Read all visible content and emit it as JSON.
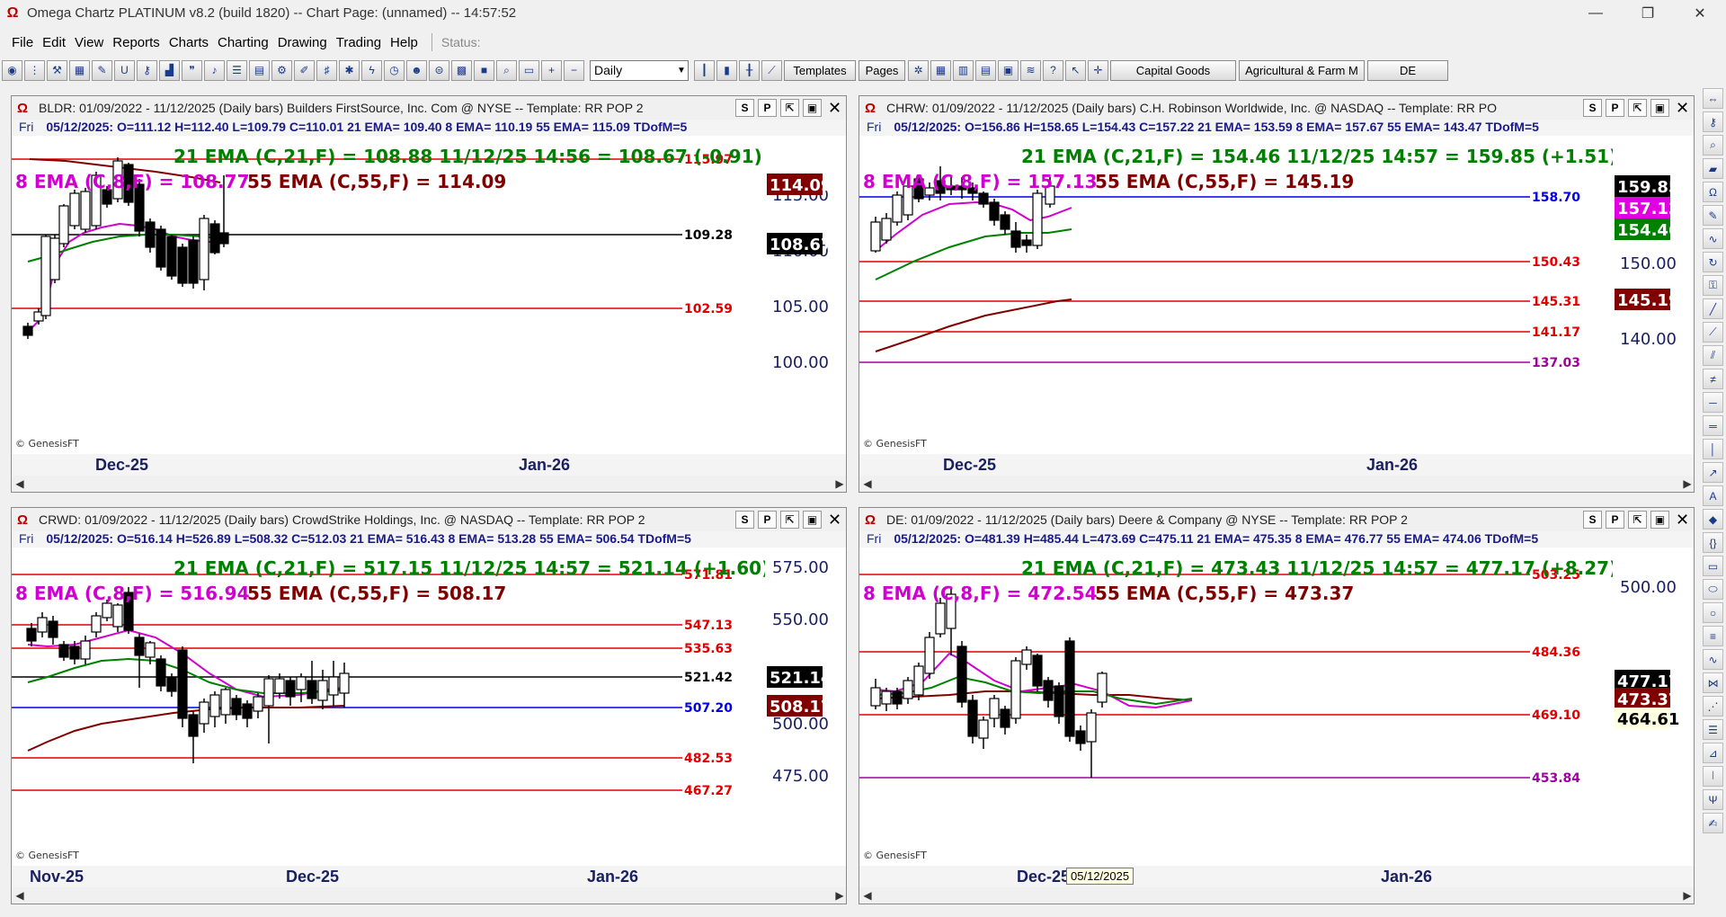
{
  "app": {
    "title": "Omega Chartz PLATINUM v8.2 (build 1820)  --  Chart Page: (unnamed) -- 14:57:52",
    "window_buttons": [
      "—",
      "❐",
      "✕"
    ]
  },
  "menu": {
    "items": [
      "File",
      "Edit",
      "View",
      "Reports",
      "Charts",
      "Charting",
      "Drawing",
      "Trading",
      "Help"
    ],
    "status": "Status:"
  },
  "toolbar": {
    "interval": "Daily",
    "buttons": [
      "Templates",
      "Pages",
      "Capital Goods",
      "Agricultural & Farm M",
      "DE"
    ]
  },
  "charts": [
    {
      "id": "bldr",
      "title": "BLDR: 01/09/2022 - 11/12/2025  (Daily bars)   Builders FirstSource, Inc. Com @ NYSE  --  Template: RR POP 2",
      "day": "Fri",
      "ohlc": "05/12/2025:  O=111.12  H=112.40  L=109.79  C=110.01  21 EMA= 109.40  8 EMA= 110.19  55 EMA= 115.09  TDofM=5",
      "line1": "21 EMA (C,21,F) = 108.88  11/12/25 14:56 = 108.67 (-0.91)",
      "line2a": "8 EMA (C,8,F) = 108.77",
      "line2b": "55 EMA (C,55,F) = 114.09",
      "price_labels": [
        "115.00",
        "110.00",
        "105.00",
        "100.00"
      ],
      "hlines": [
        {
          "label": "115.97",
          "color": "#e00000"
        },
        {
          "label": "109.28",
          "color": "#000000"
        },
        {
          "label": "102.59",
          "color": "#e00000"
        }
      ],
      "flags": [
        {
          "text": "114.09",
          "bg": "#800000",
          "fg": "#ffffff"
        },
        {
          "text": "108.67",
          "bg": "#000000",
          "fg": "#ffffff"
        }
      ],
      "x_labels": [
        "Dec-25",
        "Jan-26"
      ],
      "copyright": "© GenesisFT"
    },
    {
      "id": "chrw",
      "title": "CHRW: 01/09/2022 - 11/12/2025  (Daily bars)   C.H. Robinson Worldwide, Inc. @ NASDAQ  --  Template: RR PO",
      "day": "Fri",
      "ohlc": "05/12/2025:  O=156.86  H=158.65  L=154.43  C=157.22  21 EMA= 153.59  8 EMA= 157.67  55 EMA= 143.47  TDofM=5",
      "line1": "21 EMA (C,21,F) = 154.46  11/12/25 14:57 = 159.85 (+1.51)",
      "line2a": "8 EMA (C,8,F) = 157.13",
      "line2b": "55 EMA (C,55,F) = 145.19",
      "price_labels": [
        "150.00",
        "140.00"
      ],
      "hlines": [
        {
          "label": "158.70",
          "color": "#0000e0"
        },
        {
          "label": "150.43",
          "color": "#e00000"
        },
        {
          "label": "145.31",
          "color": "#e00000"
        },
        {
          "label": "141.17",
          "color": "#e00000"
        },
        {
          "label": "137.03",
          "color": "#a000a0"
        }
      ],
      "flags": [
        {
          "text": "159.85",
          "bg": "#000000",
          "fg": "#ffffff"
        },
        {
          "text": "157.13",
          "bg": "#e000e0",
          "fg": "#ffffff"
        },
        {
          "text": "154.46",
          "bg": "#008000",
          "fg": "#ffffff"
        },
        {
          "text": "145.19",
          "bg": "#800000",
          "fg": "#ffffff"
        }
      ],
      "x_labels": [
        "Dec-25",
        "Jan-26"
      ],
      "copyright": "© GenesisFT"
    },
    {
      "id": "crwd",
      "title": "CRWD:  01/09/2022 - 11/12/2025  (Daily bars)   CrowdStrike Holdings, Inc. @ NASDAQ  --  Template: RR POP 2",
      "day": "Fri",
      "ohlc": "05/12/2025:  O=516.14  H=526.89  L=508.32  C=512.03  21 EMA= 516.43  8 EMA= 513.28  55 EMA= 506.54  TDofM=5",
      "line1": "21 EMA (C,21,F) = 517.15  11/12/25 14:57 = 521.14 (+1.60)",
      "line2a": "8 EMA (C,8,F) = 516.94",
      "line2b": "55 EMA (C,55,F) = 508.17",
      "price_labels": [
        "575.00",
        "550.00",
        "500.00",
        "475.00"
      ],
      "hlines": [
        {
          "label": "571.81",
          "color": "#e00000"
        },
        {
          "label": "547.13",
          "color": "#e00000"
        },
        {
          "label": "535.63",
          "color": "#e00000"
        },
        {
          "label": "521.42",
          "color": "#000000"
        },
        {
          "label": "507.20",
          "color": "#0000e0"
        },
        {
          "label": "482.53",
          "color": "#e00000"
        },
        {
          "label": "467.27",
          "color": "#e00000"
        }
      ],
      "flags": [
        {
          "text": "521.14",
          "bg": "#000000",
          "fg": "#ffffff"
        },
        {
          "text": "508.17",
          "bg": "#800000",
          "fg": "#ffffff"
        }
      ],
      "x_labels": [
        "Nov-25",
        "Dec-25",
        "Jan-26"
      ],
      "copyright": "© GenesisFT"
    },
    {
      "id": "de",
      "title": "DE:  01/09/2022 - 11/12/2025  (Daily bars)   Deere & Company @ NYSE  --  Template: RR POP 2",
      "day": "Fri",
      "ohlc": "05/12/2025:  O=481.39  H=485.44  L=473.69  C=475.11  21 EMA= 475.35  8 EMA= 476.77  55 EMA= 474.06  TDofM=5",
      "line1": "21 EMA (C,21,F) = 473.43  11/12/25 14:57 = 477.17 (+8.27)",
      "line2a": "8 EMA (C,8,F) = 472.54",
      "line2b": "55 EMA (C,55,F) = 473.37",
      "price_labels": [
        "500.00"
      ],
      "hlines": [
        {
          "label": "503.25",
          "color": "#e00000"
        },
        {
          "label": "484.36",
          "color": "#e00000"
        },
        {
          "label": "469.10",
          "color": "#e00000"
        },
        {
          "label": "453.84",
          "color": "#a000a0"
        }
      ],
      "flags": [
        {
          "text": "477.17",
          "bg": "#000000",
          "fg": "#ffffff"
        },
        {
          "text": "473.37",
          "bg": "#800000",
          "fg": "#ffffff"
        },
        {
          "text": "464.61",
          "bg": "#ffffe1",
          "fg": "#000000"
        }
      ],
      "x_labels": [
        "Dec-25",
        "Jan-26"
      ],
      "tooltip": "05/12/2025",
      "copyright": "© GenesisFT"
    }
  ]
}
